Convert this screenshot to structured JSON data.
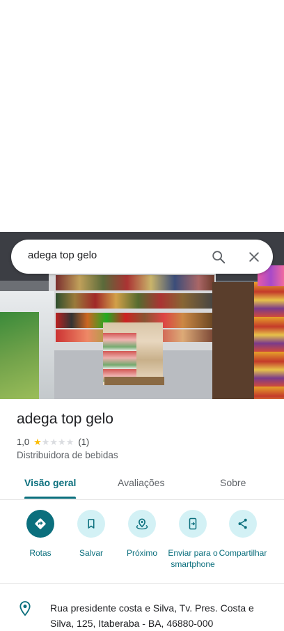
{
  "search": {
    "query": "adega top gelo"
  },
  "place": {
    "name": "adega top gelo",
    "rating_text": "1,0",
    "rating_value": 1,
    "rating_max": 5,
    "review_count_text": "(1)",
    "category": "Distribuidora de bebidas"
  },
  "tabs": [
    {
      "label": "Visão geral",
      "active": true
    },
    {
      "label": "Avaliações",
      "active": false
    },
    {
      "label": "Sobre",
      "active": false
    }
  ],
  "actions": [
    {
      "label": "Rotas",
      "icon": "directions-icon"
    },
    {
      "label": "Salvar",
      "icon": "bookmark-icon"
    },
    {
      "label": "Próximo",
      "icon": "nearby-icon"
    },
    {
      "label": "Enviar para o smartphone",
      "icon": "send-to-phone-icon"
    },
    {
      "label": "Compartilhar",
      "icon": "share-icon"
    }
  ],
  "address": {
    "text": "Rua presidente costa e Silva, Tv. Pres. Costa e Silva, 125, Itaberaba - BA, 46880-000",
    "icon": "location-pin-icon"
  },
  "colors": {
    "accent": "#0b6f7d",
    "accent_light": "#d3f1f5",
    "star": "#fbbc04"
  }
}
